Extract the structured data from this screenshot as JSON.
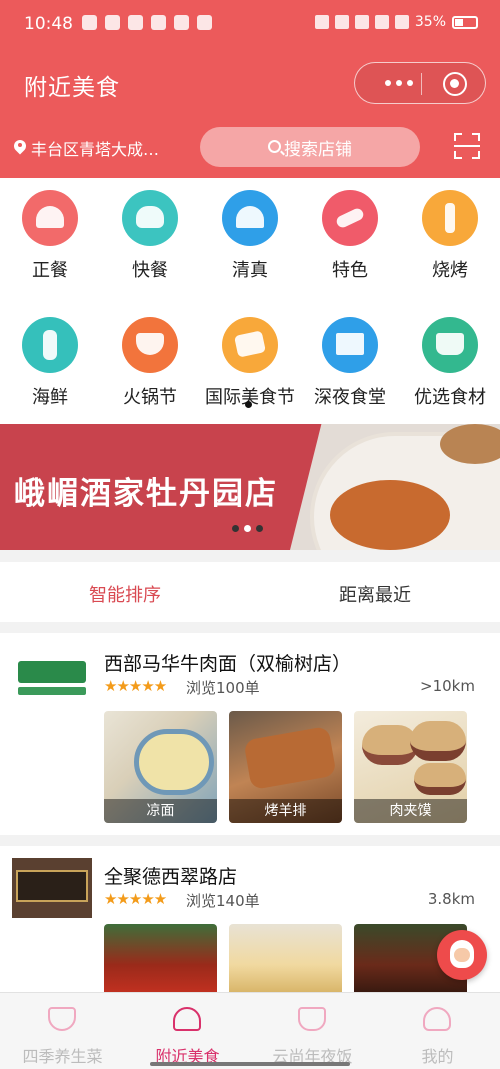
{
  "status_bar": {
    "time": "10:48",
    "battery": "35%"
  },
  "header": {
    "title": "附近美食",
    "location": "丰台区青塔大成…",
    "search_placeholder": "搜索店铺"
  },
  "categories": [
    {
      "label": "正餐",
      "icon": "cloche-icon",
      "color": "#f26a6a"
    },
    {
      "label": "快餐",
      "icon": "burger-icon",
      "color": "#3cc4c0"
    },
    {
      "label": "清真",
      "icon": "mosque-icon",
      "color": "#2f9fe8"
    },
    {
      "label": "特色",
      "icon": "chili-icon",
      "color": "#f05b6a"
    },
    {
      "label": "烧烤",
      "icon": "skewer-icon",
      "color": "#f8a83a"
    },
    {
      "label": "海鲜",
      "icon": "lobster-icon",
      "color": "#35c0bb"
    },
    {
      "label": "火锅节",
      "icon": "hotpot-icon",
      "color": "#f2743c"
    },
    {
      "label": "国际美食节",
      "icon": "card-icon",
      "color": "#f8a83a"
    },
    {
      "label": "深夜食堂",
      "icon": "stall-icon",
      "color": "#2f9fe8"
    },
    {
      "label": "优选食材",
      "icon": "basket-icon",
      "color": "#33b88f"
    }
  ],
  "banner": {
    "text": "峨嵋酒家牡丹园店"
  },
  "sort_tabs": [
    "智能排序",
    "距离最近"
  ],
  "shops": [
    {
      "name": "西部马华牛肉面（双榆树店）",
      "stars": "★★★★★",
      "views": "浏览100单",
      "distance": ">10km",
      "dishes": [
        "凉面",
        "烤羊排",
        "肉夹馍"
      ]
    },
    {
      "name": "全聚德西翠路店",
      "stars": "★★★★★",
      "views": "浏览140单",
      "distance": "3.8km",
      "dishes": []
    }
  ],
  "tabbar": [
    {
      "label": "四季养生菜",
      "icon": "bowl-icon",
      "active": false
    },
    {
      "label": "附近美食",
      "icon": "cloche-icon",
      "active": true
    },
    {
      "label": "云尚年夜饭",
      "icon": "pot-icon",
      "active": false
    },
    {
      "label": "我的",
      "icon": "user-icon",
      "active": false
    }
  ]
}
